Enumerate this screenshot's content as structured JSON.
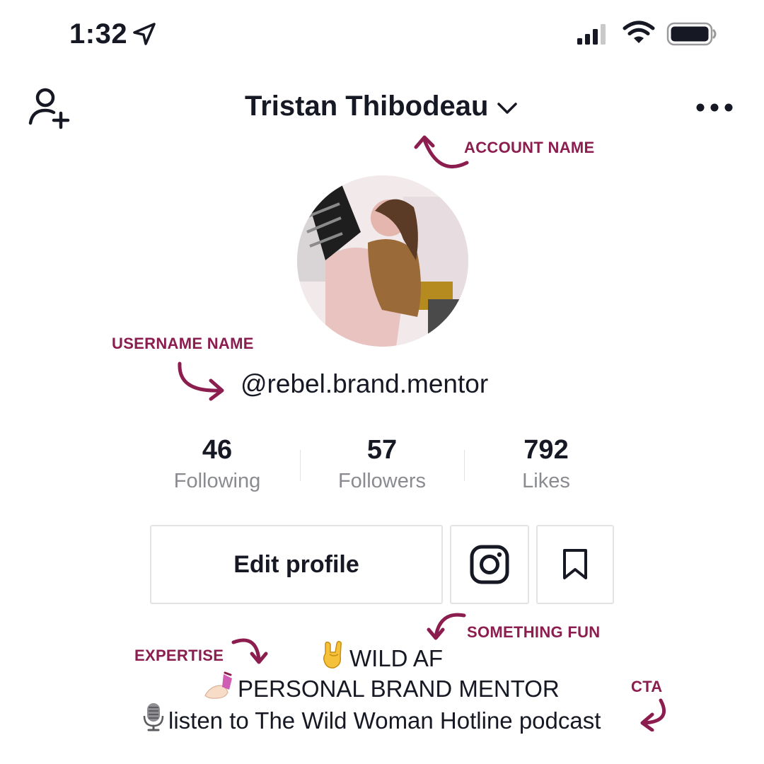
{
  "status_bar": {
    "time": "1:32"
  },
  "header": {
    "account_name": "Tristan Thibodeau"
  },
  "profile": {
    "username": "@rebel.brand.mentor"
  },
  "stats": [
    {
      "value": "46",
      "label": "Following"
    },
    {
      "value": "57",
      "label": "Followers"
    },
    {
      "value": "792",
      "label": "Likes"
    }
  ],
  "actions": {
    "edit_profile": "Edit profile"
  },
  "bio": {
    "line1": "WILD AF",
    "line2": "PERSONAL BRAND MENTOR",
    "line3": "listen to The Wild Woman Hotline podcast"
  },
  "annotations": {
    "account_name": "ACCOUNT NAME",
    "username": "USERNAME NAME",
    "something_fun": "SOMETHING FUN",
    "expertise": "EXPERTISE",
    "cta": "CTA"
  },
  "colors": {
    "annotation": "#8b1d4f",
    "text": "#161823",
    "muted": "#8a8b91",
    "border": "#e3e3e4"
  },
  "icons": [
    "location-arrow-icon",
    "signal-icon",
    "wifi-icon",
    "battery-icon",
    "add-user-icon",
    "chevron-down-icon",
    "more-icon",
    "instagram-icon",
    "bookmark-icon",
    "rock-hand-icon",
    "nail-polish-icon",
    "microphone-icon"
  ]
}
